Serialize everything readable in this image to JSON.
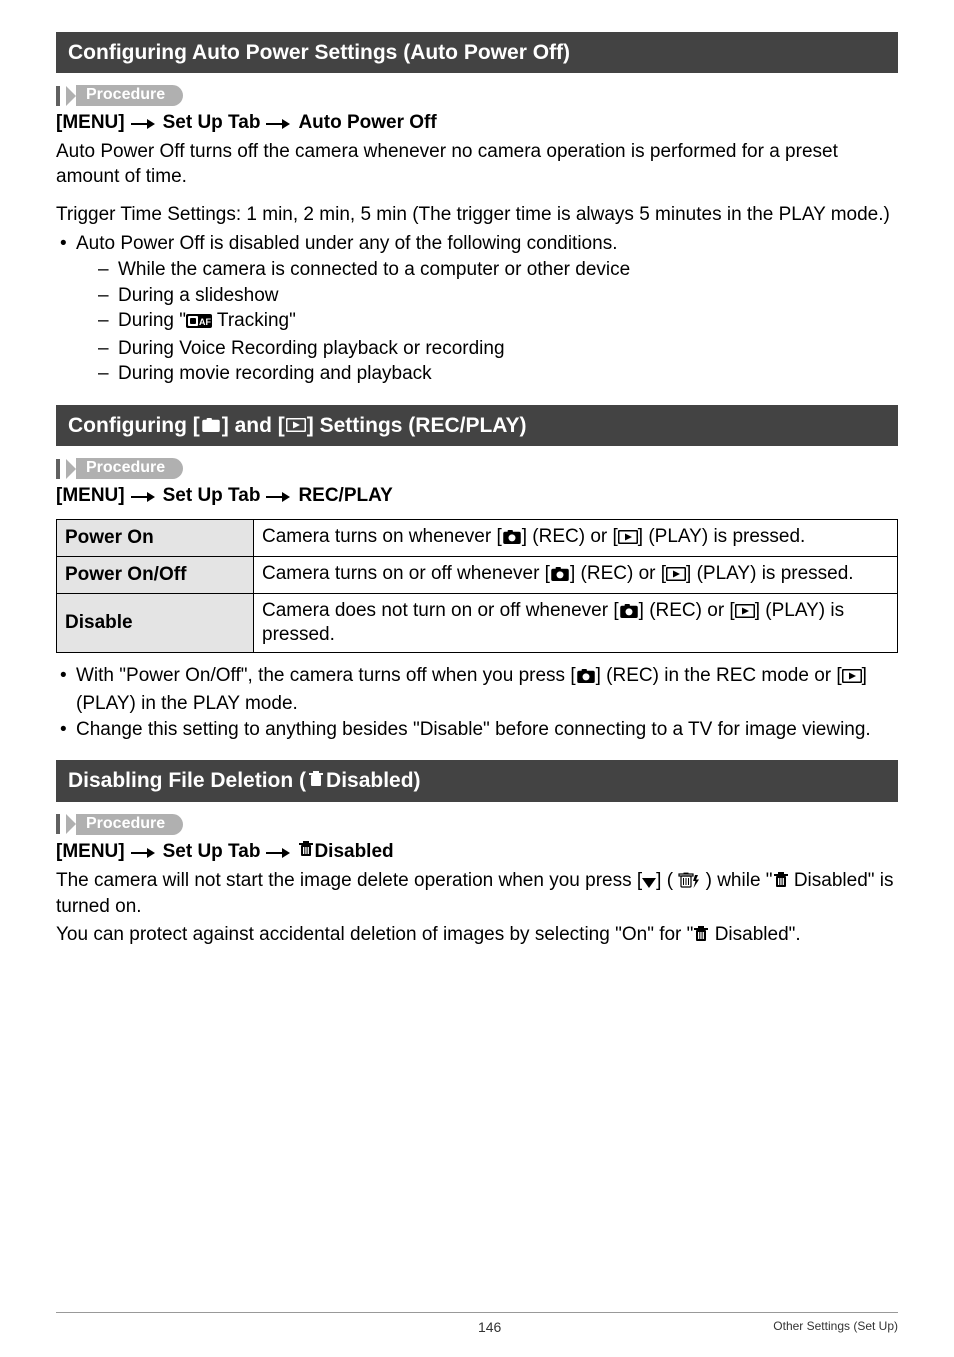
{
  "section1": {
    "header": "Configuring Auto Power Settings (Auto Power Off)",
    "procedure": "Procedure",
    "menu_prefix": "[MENU]",
    "menu_mid": "Set Up Tab",
    "menu_tail": "Auto Power Off",
    "para1": "Auto Power Off turns off the camera whenever no camera operation is performed for a preset amount of time.",
    "para2": "Trigger Time Settings: 1 min, 2 min, 5 min (The trigger time is always 5 minutes in the PLAY mode.)",
    "bullet": "Auto Power Off is disabled under any of the following conditions.",
    "dash1": "While the camera is connected to a computer or other device",
    "dash2": "During a slideshow",
    "dash3_pre": "During \"",
    "dash3_post": " Tracking\"",
    "dash4": "During Voice Recording playback or recording",
    "dash5": "During movie recording and playback"
  },
  "section2": {
    "header_pre": "Configuring [",
    "header_mid": "] and [",
    "header_post": "] Settings (REC/PLAY)",
    "procedure": "Procedure",
    "menu_prefix": "[MENU]",
    "menu_mid": "Set Up Tab",
    "menu_tail": "REC/PLAY",
    "row1_k": "Power On",
    "row1_v_a": "Camera turns on whenever [",
    "row1_v_b": "] (REC) or [",
    "row1_v_c": "] (PLAY) is pressed.",
    "row2_k": "Power On/Off",
    "row2_v_a": "Camera turns on or off whenever [",
    "row2_v_b": "] (REC) or [",
    "row2_v_c": "] (PLAY) is pressed.",
    "row3_k": "Disable",
    "row3_v_a": "Camera does not turn on or off whenever [",
    "row3_v_b": "] (REC) or [",
    "row3_v_c": "] (PLAY) is pressed.",
    "note1_a": "With \"Power On/Off\", the camera turns off when you press [",
    "note1_b": "] (REC) in the REC mode or [",
    "note1_c": "] (PLAY) in the PLAY mode.",
    "note2": "Change this setting to anything besides \"Disable\" before connecting to a TV for image viewing."
  },
  "section3": {
    "header_pre": "Disabling File Deletion (",
    "header_post": " Disabled)",
    "procedure": "Procedure",
    "menu_prefix": "[MENU]",
    "menu_mid": "Set Up Tab",
    "menu_tail": " Disabled",
    "para1_a": "The camera will not start the image delete operation when you press [",
    "para1_b": "] ( ",
    "para1_c": " ) while \"",
    "para1_d": " Disabled\" is turned on.",
    "para2_a": "You can protect against accidental deletion of images by selecting \"On\" for \"",
    "para2_b": " Disabled\"."
  },
  "footer": {
    "page": "146",
    "section": "Other Settings (Set Up)"
  }
}
